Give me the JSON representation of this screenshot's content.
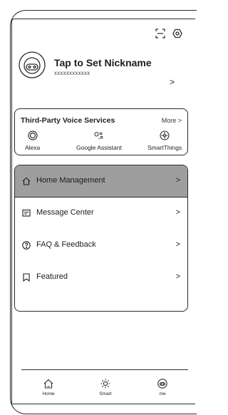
{
  "header": {
    "icons": [
      "scan-icon",
      "settings-icon"
    ]
  },
  "profile": {
    "nickname": "Tap to Set Nickname",
    "user_id": "xxxxxxxxxxxx",
    "chevron": ">"
  },
  "voice_services": {
    "title": "Third-Party Voice Services",
    "more": "More >",
    "items": [
      {
        "label": "Alexa",
        "icon": "alexa-icon"
      },
      {
        "label": "Google Assistant",
        "icon": "google-assistant-icon"
      },
      {
        "label": "SmartThings",
        "icon": "smartthings-icon"
      }
    ]
  },
  "menu": {
    "items": [
      {
        "label": "Home Management",
        "icon": "home-icon",
        "active": true
      },
      {
        "label": "Message Center",
        "icon": "message-icon"
      },
      {
        "label": "FAQ & Feedback",
        "icon": "help-icon"
      },
      {
        "label": "Featured",
        "icon": "bookmark-icon"
      }
    ],
    "chevron": ">"
  },
  "tabbar": {
    "items": [
      {
        "label": "Home",
        "icon": "home-icon"
      },
      {
        "label": "Smart",
        "icon": "sun-icon"
      },
      {
        "label": "me",
        "icon": "profile-icon",
        "active": true
      }
    ]
  },
  "colors": {
    "active_row": "#9e9e9e",
    "stroke": "#2b2b2b"
  }
}
